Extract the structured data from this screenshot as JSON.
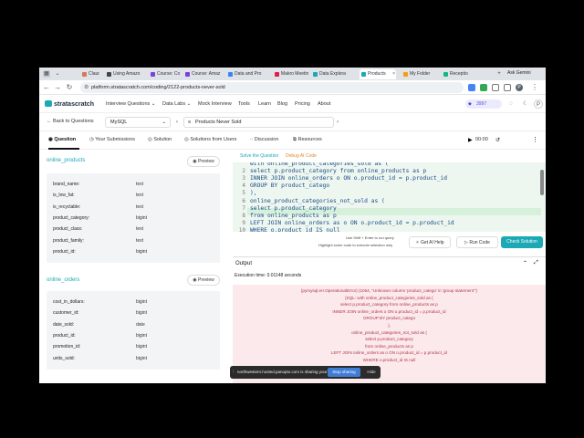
{
  "browser": {
    "tabs": [
      {
        "label": "Claude",
        "color": "#d97757"
      },
      {
        "label": "Using Amazo",
        "color": "#444444"
      },
      {
        "label": "Course: Conte",
        "color": "#7b3fe4"
      },
      {
        "label": "Course: Amaz",
        "color": "#7b3fe4"
      },
      {
        "label": "Data and Pro",
        "color": "#3b82f6"
      },
      {
        "label": "Makro Meetin",
        "color": "#e11d48"
      },
      {
        "label": "Data Explora",
        "color": "#1aa9b5"
      },
      {
        "label": "Products",
        "color": "#1aa9b5"
      },
      {
        "label": "My Folder",
        "color": "#f59e0b"
      },
      {
        "label": "Receptio",
        "color": "#10b981"
      }
    ],
    "ask_gemini": "Ask Gemini",
    "url": "platform.stratascratch.com/coding/2122-products-never-sold",
    "profile_letter": "P"
  },
  "site": {
    "logo": "stratascratch",
    "menu": [
      "Interview Questions",
      "Data Labs",
      "Mock Interview",
      "Tools",
      "Learn",
      "Blog",
      "Pricing",
      "About"
    ],
    "plan_count": "3997",
    "profile_letter": "P"
  },
  "subheader": {
    "back_label": "Back to Questions",
    "language": "MySQL",
    "question": "Products Never Sold"
  },
  "navtabs": {
    "items": [
      "Question",
      "Your Submissions",
      "Solution",
      "Solutions from Users",
      "Discussion",
      "Resources"
    ],
    "timer": "00:00"
  },
  "tables": [
    {
      "name": "online_products",
      "preview": "Preview",
      "columns": [
        {
          "name": "brand_name:",
          "type": "text"
        },
        {
          "name": "is_low_fat:",
          "type": "text"
        },
        {
          "name": "is_recyclable:",
          "type": "text"
        },
        {
          "name": "product_category:",
          "type": "bigint"
        },
        {
          "name": "product_class:",
          "type": "text"
        },
        {
          "name": "product_family:",
          "type": "text"
        },
        {
          "name": "product_id:",
          "type": "bigint"
        }
      ]
    },
    {
      "name": "online_orders",
      "preview": "Preview",
      "columns": [
        {
          "name": "cost_in_dollars:",
          "type": "bigint"
        },
        {
          "name": "customer_id:",
          "type": "bigint"
        },
        {
          "name": "date_sold:",
          "type": "date"
        },
        {
          "name": "product_id:",
          "type": "bigint"
        },
        {
          "name": "promotion_id:",
          "type": "bigint"
        },
        {
          "name": "units_sold:",
          "type": "bigint"
        }
      ]
    }
  ],
  "editor": {
    "tabs": [
      "Solve the Question",
      "Debug AI Code"
    ],
    "lines": [
      {
        "n": "",
        "code": "with online_product_categories_sold as ("
      },
      {
        "n": "2",
        "code": "select p.product_category from online_products as p"
      },
      {
        "n": "3",
        "code": "INNER JOIN online_orders o ON o.product_id = p.product_id"
      },
      {
        "n": "4",
        "code": "GROUP BY product_catego"
      },
      {
        "n": "5",
        "code": "),"
      },
      {
        "n": "6",
        "code": "online_product_categories_not_sold as ("
      },
      {
        "n": "7",
        "code": "select p.product_category"
      },
      {
        "n": "8",
        "code": "from online_products as p"
      },
      {
        "n": "9",
        "code": "LEFT JOIN online_orders as o ON o.product_id = p.product_id"
      },
      {
        "n": "10",
        "code": "WHERE o.product_id IS null"
      }
    ],
    "hint1": "Use Shift + Enter to run query",
    "hint2": "Highlight some code to execute selection only",
    "get_ai_help": "Get AI Help",
    "run_code": "Run Code",
    "check_solution": "Check Solution"
  },
  "output": {
    "title": "Output",
    "execution_time": "Execution time: 0.01148 seconds",
    "error_lines": [
      "(pymysql.err.OperationalError) (1054, \"Unknown column 'product_catego' in 'group statement'\")",
      "[SQL: with online_product_categories_sold as (",
      "select p.product_category from online_products as p",
      "INNER JOIN online_orders o ON o.product_id = p.product_id",
      "GROUP BY product_catego",
      "),",
      "online_product_categories_not_sold as (",
      "select p.product_category",
      "from online_products as p",
      "LEFT JOIN online_orders as o ON o.product_id = p.product_id",
      "WHERE o.product_id IS null"
    ]
  },
  "share_banner": {
    "text": "northwestern.hosted.panopto.com is sharing your screen.",
    "stop": "Stop sharing",
    "hide": "Hide"
  },
  "colors": {
    "accent": "#1aa9b5",
    "error_bg": "#fbe9eb",
    "error_text": "#b0364a",
    "editor_bg": "#eef7ef"
  }
}
